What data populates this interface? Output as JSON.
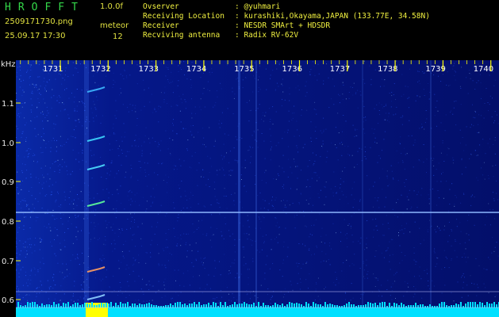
{
  "header": {
    "brand": "HROFFT",
    "version": "1.0.0f",
    "filename": "2509171730.png",
    "datetime": "25.09.17 17:30",
    "meteor_label": "meteor",
    "meteor_count": "12",
    "info_rows": [
      {
        "key": "Ovserver",
        "value": ": @yuhmari"
      },
      {
        "key": "Receiving Location",
        "value": ": kurashiki,Okayama,JAPAN (133.77E, 34.58N)"
      },
      {
        "key": "Receiver",
        "value": ": NESDR SMArt + HDSDR"
      },
      {
        "key": "Recviving antenna",
        "value": ": Radix RV-62V"
      }
    ]
  },
  "spectrogram": {
    "y_unit": "kHz",
    "y_ticks": [
      "1.1",
      "1.0",
      "0.9",
      "0.8",
      "0.7",
      "0.6"
    ],
    "x_ticks": [
      "1731",
      "1732",
      "1733",
      "1734",
      "1735",
      "1736",
      "1737",
      "1738",
      "1739",
      "1740"
    ],
    "colors": {
      "background": "#000a4a",
      "noise": "#2a5cff",
      "signal": "#00e0ff",
      "ticks": "#ffff00"
    }
  }
}
